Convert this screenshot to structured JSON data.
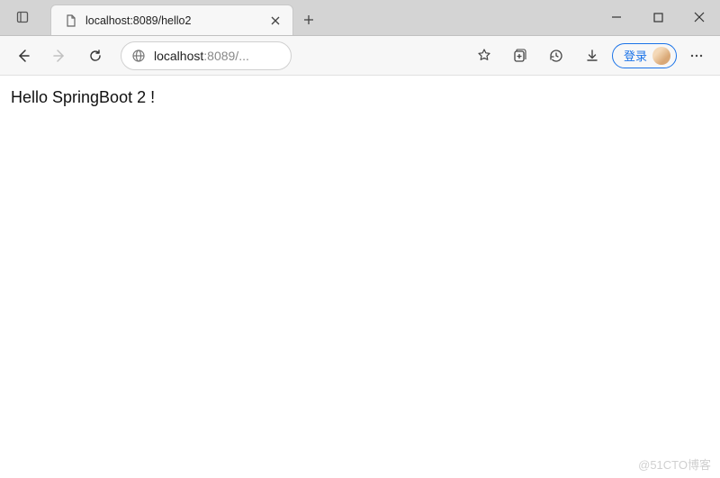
{
  "titlebar": {
    "tab_title": "localhost:8089/hello2"
  },
  "toolbar": {
    "address_host": "localhost",
    "address_rest": ":8089/...",
    "login_label": "登录"
  },
  "page": {
    "body_text": "Hello SpringBoot 2 !"
  },
  "watermark": {
    "text": "@51CTO博客"
  }
}
